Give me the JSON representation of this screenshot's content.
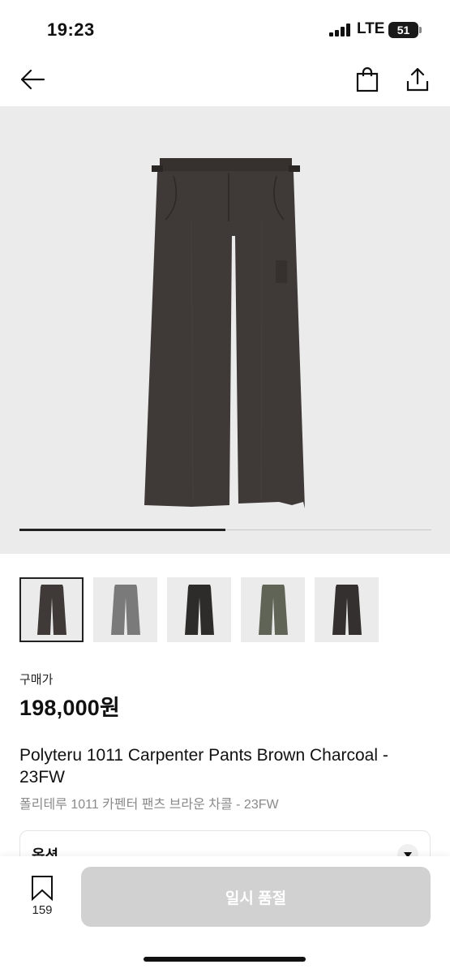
{
  "status_bar": {
    "time": "19:23",
    "network": "LTE",
    "battery": "51"
  },
  "nav": {
    "back_icon": "arrow-left-icon",
    "bag_icon": "shopping-bag-icon",
    "share_icon": "share-icon"
  },
  "hero": {
    "image_progress": 0.5,
    "colors": {
      "pants": "#3f3a38",
      "background": "#ebebeb"
    }
  },
  "thumbnails": [
    {
      "variant": "brown charcoal",
      "color": "#3f3a38",
      "selected": true
    },
    {
      "variant": "grey",
      "color": "#7a7a7a",
      "selected": false
    },
    {
      "variant": "black",
      "color": "#2e2c2b",
      "selected": false
    },
    {
      "variant": "olive",
      "color": "#5f6456",
      "selected": false
    },
    {
      "variant": "dark charcoal",
      "color": "#34302f",
      "selected": false
    }
  ],
  "price": {
    "label": "구매가",
    "value": "198,000원"
  },
  "product": {
    "title_en": "Polyteru 1011 Carpenter Pants Brown Charcoal - 23FW",
    "title_ko": "폴리테루 1011 카펜터 팬츠 브라운 차콜 - 23FW"
  },
  "option": {
    "label": "옵션"
  },
  "bottom_bar": {
    "wish_count": "159",
    "soldout_label": "일시 품절"
  }
}
